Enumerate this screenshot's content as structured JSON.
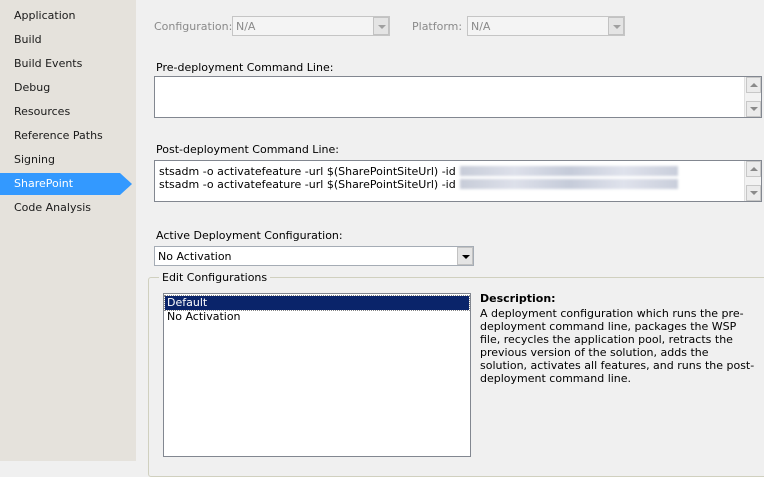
{
  "sidebar": {
    "items": [
      {
        "label": "Application"
      },
      {
        "label": "Build"
      },
      {
        "label": "Build Events"
      },
      {
        "label": "Debug"
      },
      {
        "label": "Resources"
      },
      {
        "label": "Reference Paths"
      },
      {
        "label": "Signing"
      },
      {
        "label": "SharePoint",
        "selected": true
      },
      {
        "label": "Code Analysis"
      }
    ]
  },
  "config": {
    "configuration_label": "Configuration:",
    "configuration_value": "N/A",
    "platform_label": "Platform:",
    "platform_value": "N/A"
  },
  "pre_deployment": {
    "label": "Pre-deployment Command Line:",
    "lines": []
  },
  "post_deployment": {
    "label": "Post-deployment Command Line:",
    "lines": [
      "stsadm -o activatefeature -url $(SharePointSiteUrl) -id",
      "stsadm -o activatefeature -url $(SharePointSiteUrl) -id"
    ]
  },
  "active_deployment": {
    "label": "Active Deployment Configuration:",
    "value": "No Activation"
  },
  "edit_configurations": {
    "title": "Edit Configurations",
    "items": [
      {
        "label": "Default",
        "selected": true
      },
      {
        "label": "No Activation",
        "selected": false
      }
    ],
    "description_title": "Description:",
    "description_text": "A deployment configuration which runs the pre-deployment command line, packages the WSP file, recycles the application pool, retracts the previous version of the solution, adds the solution, activates all features, and runs the post-deployment command line."
  },
  "colors": {
    "selection": "#3399ff",
    "list_selection": "#0a246a",
    "sidebar_bg": "#e5e2dc"
  }
}
